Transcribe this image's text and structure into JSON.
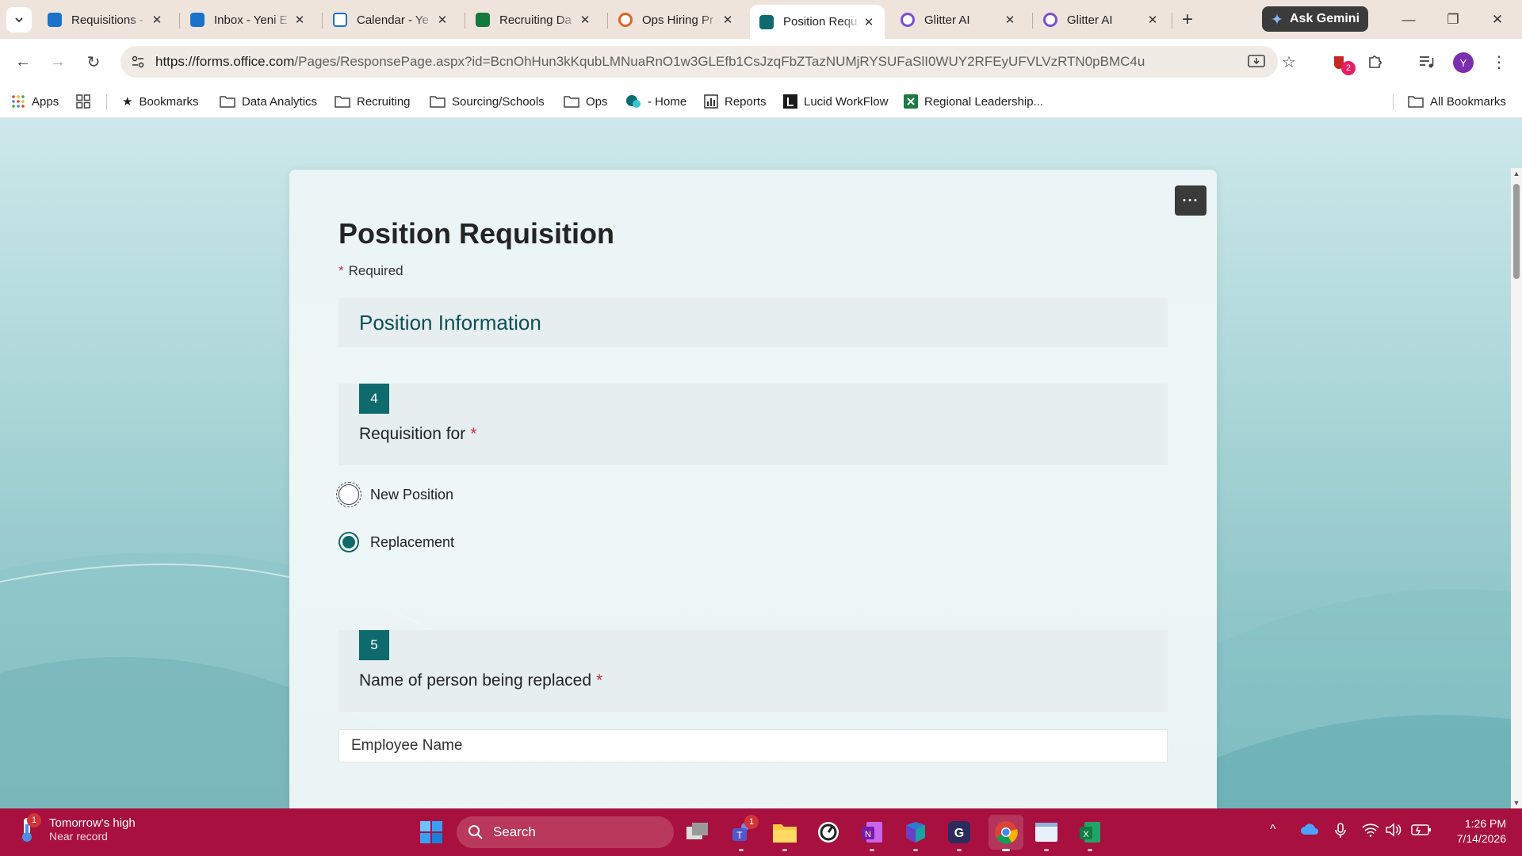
{
  "browser": {
    "tabs": [
      {
        "title": "Requisitions - ",
        "favicon": "outlook-icon",
        "active": false
      },
      {
        "title": "Inbox - Yeni E",
        "favicon": "outlook-icon",
        "active": false
      },
      {
        "title": "Calendar - Ye",
        "favicon": "calendar-icon",
        "active": false
      },
      {
        "title": "Recruiting Da",
        "favicon": "planner-icon",
        "active": false
      },
      {
        "title": "Ops Hiring Pr",
        "favicon": "office-icon",
        "active": false
      },
      {
        "title": "Position Requ",
        "favicon": "forms-icon",
        "active": true
      },
      {
        "title": "Glitter AI",
        "favicon": "glitter-icon",
        "active": false
      },
      {
        "title": "Glitter AI",
        "favicon": "glitter-icon",
        "active": false
      }
    ],
    "gemini_label": "Ask Gemini",
    "url_host": "https://forms.office.com",
    "url_path": "/Pages/ResponsePage.aspx?id=BcnOhHun3kKqubLMNuaRnO1w3GLEfb1CsJzqFbZTazNUMjRYSUFaSlI0WUY2RFEyUFVLVzRTN0pBMC4u",
    "extension_badge": "2",
    "profile_initial": "Y"
  },
  "bookmarks": {
    "apps": "Apps",
    "items": [
      {
        "label": "Bookmarks",
        "icon": "star-icon"
      },
      {
        "label": "Data Analytics",
        "icon": "folder-icon"
      },
      {
        "label": "Recruiting",
        "icon": "folder-icon"
      },
      {
        "label": "Sourcing/Schools",
        "icon": "folder-icon"
      },
      {
        "label": "Ops",
        "icon": "folder-icon"
      },
      {
        "label": "- Home",
        "icon": "sharepoint-icon"
      },
      {
        "label": "Reports",
        "icon": "chart-icon"
      },
      {
        "label": "Lucid WorkFlow",
        "icon": "lucid-icon"
      },
      {
        "label": "Regional Leadership...",
        "icon": "excel-icon"
      }
    ],
    "all_bookmarks": "All Bookmarks"
  },
  "form": {
    "title": "Position Requisition",
    "required_star": "*",
    "required_label": "Required",
    "section_title": "Position Information",
    "questions": [
      {
        "number": "4",
        "text": "Requisition for",
        "required": "*",
        "options": [
          {
            "label": "New Position",
            "selected": false
          },
          {
            "label": "Replacement",
            "selected": true
          }
        ]
      },
      {
        "number": "5",
        "text": "Name of person being replaced",
        "required": "*",
        "input_value": "Employee Name"
      }
    ],
    "more_label": "···"
  },
  "taskbar": {
    "weather_line1": "Tomorrow's high",
    "weather_line2": "Near record",
    "weather_badge": "1",
    "search_label": "Search",
    "teams_badge": "1",
    "time": "1:26 PM",
    "date": "7/14/2026"
  },
  "colors": {
    "accent": "#0f6a6e",
    "taskbar": "#a8113f",
    "required": "#c4314b"
  }
}
